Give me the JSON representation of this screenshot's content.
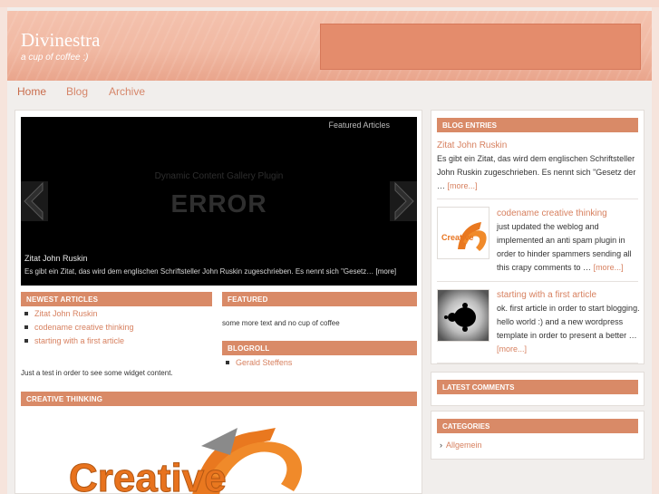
{
  "site": {
    "title": "Divinestra",
    "tagline": "a cup of coffee :)"
  },
  "nav": [
    "Home",
    "Blog",
    "Archive"
  ],
  "gallery": {
    "featured_label": "Featured Articles",
    "plugin_label": "Dynamic Content Gallery Plugin",
    "error_label": "ERROR",
    "caption_title": "Zitat John Ruskin",
    "caption_text": "Es gibt ein Zitat, das wird dem englischen Schriftsteller John Ruskin zugeschrieben. Es nennt sich \"Gesetz…",
    "caption_more": "[more]"
  },
  "newest_articles": {
    "heading": "NEWEST ARTICLES",
    "items": [
      "Zitat John Ruskin",
      "codename creative thinking",
      "starting with a first article"
    ]
  },
  "featured": {
    "heading": "FEATURED",
    "text": "some more text and no cup of coffee"
  },
  "blogroll": {
    "heading": "BLOGROLL",
    "items": [
      "Gerald Steffens"
    ]
  },
  "widget_text": "Just a test in order to see some widget content.",
  "creative_thinking": {
    "heading": "CREATIVE THINKING",
    "logo_text": "Creative"
  },
  "blog_entries": {
    "heading": "BLOG ENTRIES",
    "posts": [
      {
        "title": "Zitat John Ruskin",
        "excerpt": "Es gibt ein Zitat, das wird dem englischen Schriftsteller John Ruskin zugeschrieben. Es nennt sich \"Gesetz der …",
        "more": "[more...]"
      },
      {
        "title": "codename creative thinking",
        "excerpt": "just updated the weblog and implemented an anti spam plugin in order to hinder spammers sending all this crapy comments to …",
        "more": "[more...]"
      },
      {
        "title": "starting with a first article",
        "excerpt": "ok. first article in order to start blogging. hello world :) and a new wordpress template in order to present a better …",
        "more": "[more...]"
      }
    ]
  },
  "latest_comments": {
    "heading": "LATEST COMMENTS"
  },
  "categories": {
    "heading": "CATEGORIES",
    "items": [
      "Allgemein"
    ]
  },
  "colors": {
    "accent": "#d98a67",
    "link": "#d7805f",
    "header_box": "#e48c6c"
  }
}
